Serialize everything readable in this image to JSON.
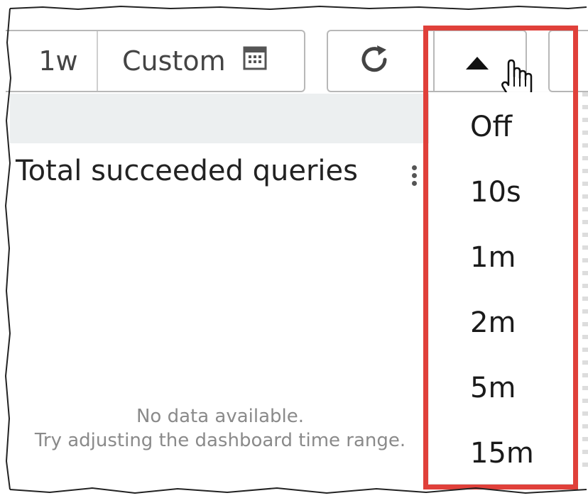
{
  "toolbar": {
    "time_ranges": [
      "1w",
      "Custom"
    ],
    "refresh_icon": "refresh-icon",
    "calendar_icon": "calendar-icon",
    "dropdown_caret_icon": "caret-up-icon"
  },
  "panel": {
    "title": "Total succeeded queries",
    "menu_icon": "kebab-menu-icon",
    "empty_title": "No data available.",
    "empty_hint": "Try adjusting the dashboard time range."
  },
  "refresh_menu": {
    "options": [
      "Off",
      "10s",
      "1m",
      "2m",
      "5m",
      "15m"
    ]
  },
  "colors": {
    "highlight": "#e0403a",
    "band": "#eceff0",
    "border": "#b8b8b8"
  }
}
